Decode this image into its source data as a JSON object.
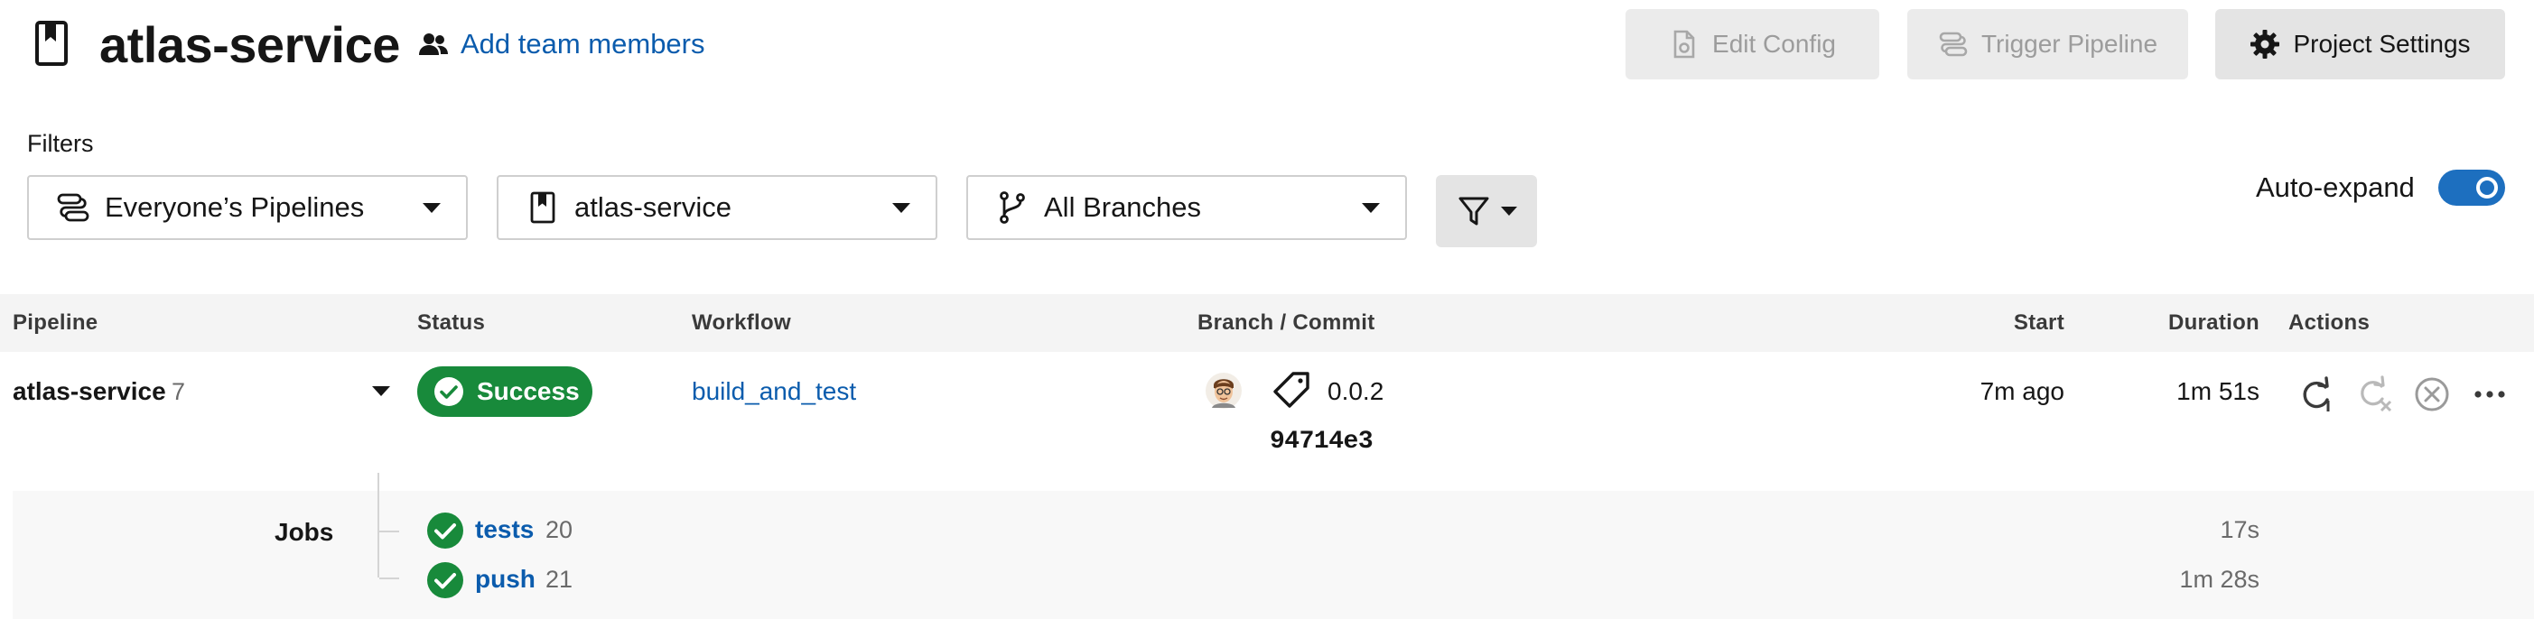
{
  "header": {
    "project_title": "atlas-service",
    "add_team_label": "Add team members",
    "edit_config_label": "Edit Config",
    "trigger_pipeline_label": "Trigger Pipeline",
    "project_settings_label": "Project Settings"
  },
  "filters": {
    "label": "Filters",
    "pipelines_value": "Everyone’s Pipelines",
    "project_value": "atlas-service",
    "branches_value": "All Branches",
    "auto_expand_label": "Auto-expand",
    "auto_expand_on": true
  },
  "table": {
    "columns": [
      "Pipeline",
      "Status",
      "Workflow",
      "Branch / Commit",
      "Start",
      "Duration",
      "Actions"
    ],
    "rows": [
      {
        "pipeline": "atlas-service",
        "number": "7",
        "status": "Success",
        "workflow": "build_and_test",
        "tag": "0.0.2",
        "commit": "94714e3",
        "start": "7m ago",
        "duration": "1m 51s",
        "jobs_label": "Jobs",
        "jobs": [
          {
            "name": "tests",
            "number": "20",
            "duration": "17s"
          },
          {
            "name": "push",
            "number": "21",
            "duration": "1m 28s"
          }
        ]
      }
    ]
  },
  "colors": {
    "success": "#188a3b",
    "link": "#0b5cad",
    "toggle": "#1d6fbf"
  },
  "icons": {
    "project": "bookmark-icon",
    "team": "people-icon",
    "edit_config": "file-gear-icon",
    "trigger": "pipeline-icon",
    "settings": "gear-icon",
    "branch": "git-branch-icon",
    "filter": "funnel-icon",
    "tag": "tag-icon",
    "rerun": "rerun-icon",
    "rerun_failed": "rerun-failed-icon",
    "cancel": "cancel-icon",
    "more": "more-icon"
  }
}
